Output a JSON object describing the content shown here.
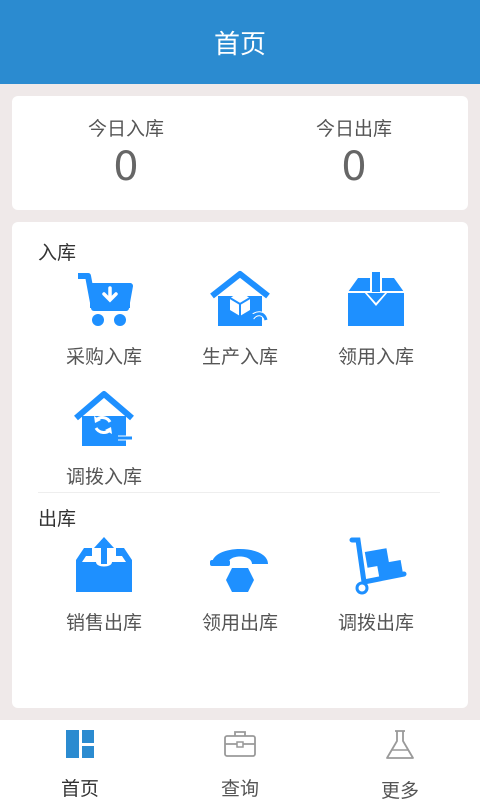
{
  "header": {
    "title": "首页"
  },
  "stats": {
    "in_label": "今日入库",
    "in_value": "0",
    "out_label": "今日出库",
    "out_value": "0"
  },
  "inbound": {
    "title": "入库",
    "items": [
      {
        "label": "采购入库",
        "icon": "cart-download-icon"
      },
      {
        "label": "生产入库",
        "icon": "warehouse-return-icon"
      },
      {
        "label": "领用入库",
        "icon": "box-download-icon"
      },
      {
        "label": "调拨入库",
        "icon": "house-transfer-icon"
      }
    ]
  },
  "outbound": {
    "title": "出库",
    "items": [
      {
        "label": "销售出库",
        "icon": "tray-upload-icon"
      },
      {
        "label": "领用出库",
        "icon": "helmet-hex-icon"
      },
      {
        "label": "调拨出库",
        "icon": "handcart-icon"
      }
    ]
  },
  "tabs": [
    {
      "label": "首页",
      "icon": "dashboard-icon",
      "active": true
    },
    {
      "label": "查询",
      "icon": "briefcase-icon",
      "active": false
    },
    {
      "label": "更多",
      "icon": "flask-icon",
      "active": false
    }
  ],
  "colors": {
    "primary": "#2b8bd0",
    "icon_blue": "#1e90ff",
    "background": "#efe9e9"
  }
}
